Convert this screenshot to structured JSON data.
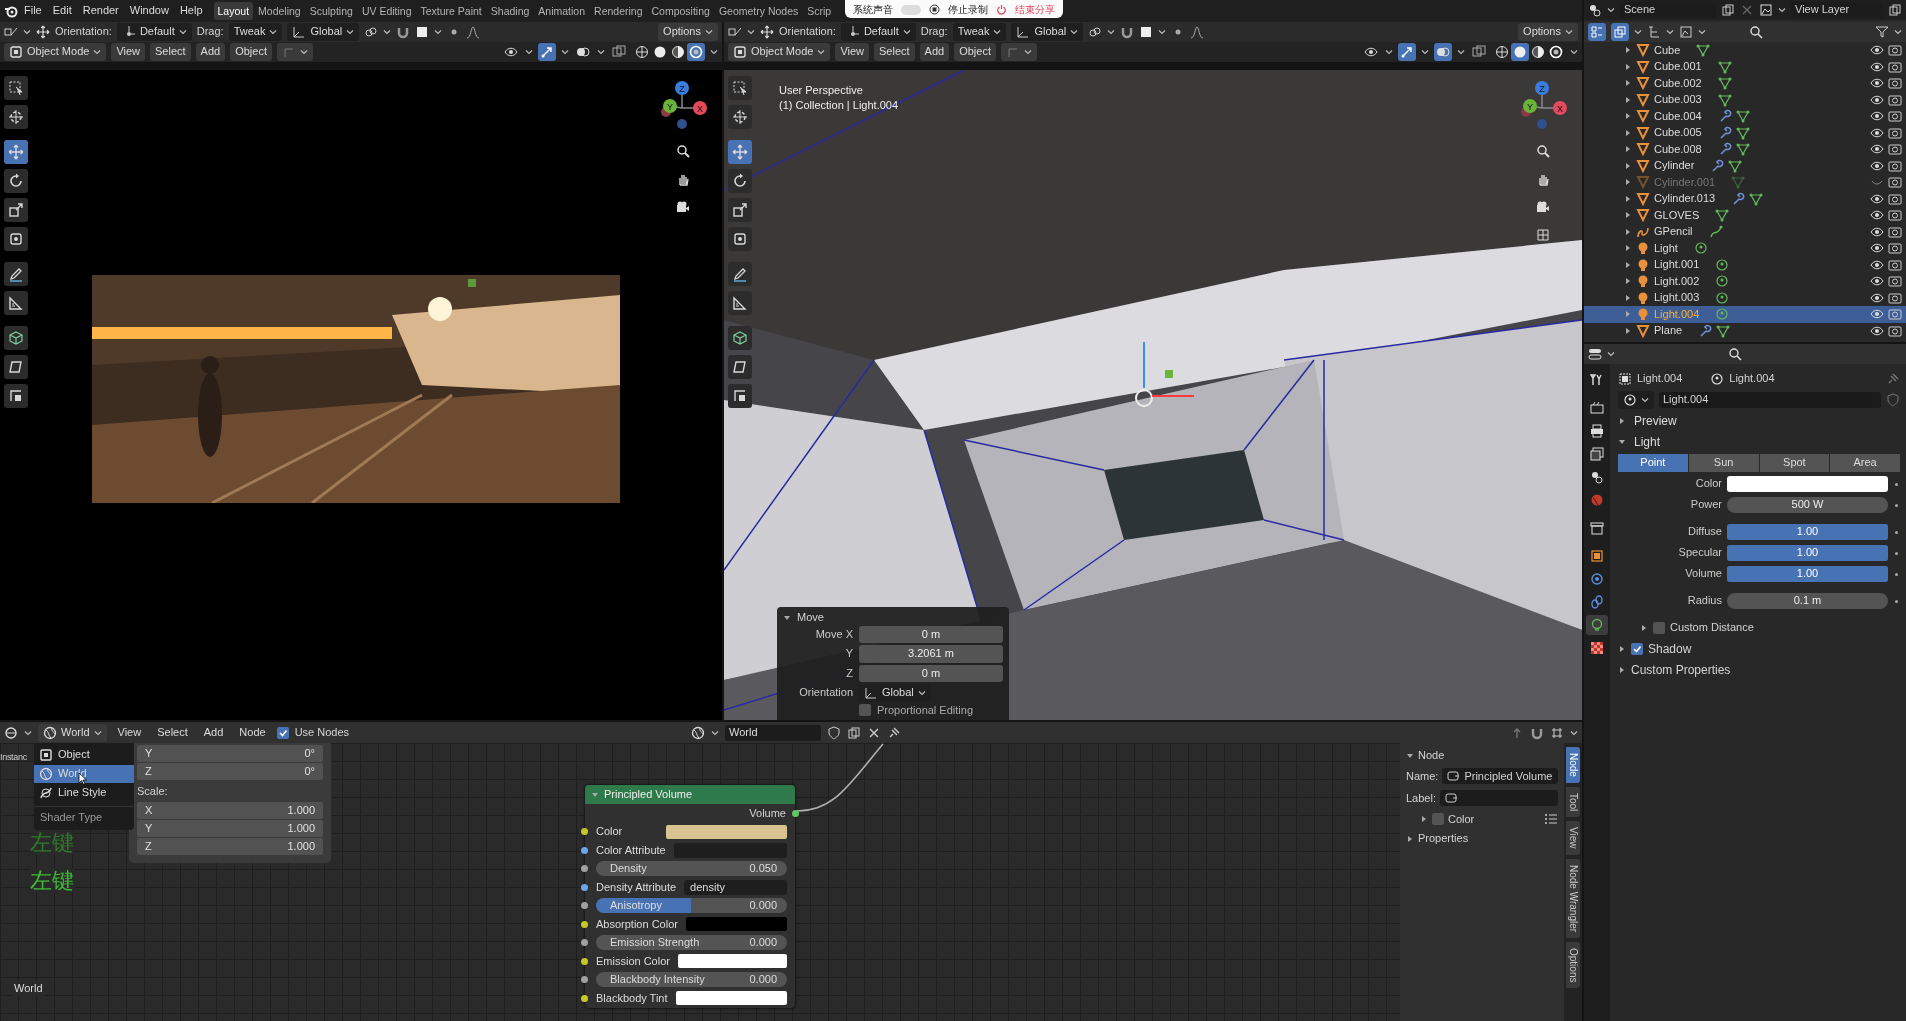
{
  "menu_bar": {
    "menus": [
      "File",
      "Edit",
      "Render",
      "Window",
      "Help"
    ],
    "workspaces": [
      {
        "label": "Layout",
        "selected": true
      },
      {
        "label": "Modeling",
        "selected": false
      },
      {
        "label": "Sculpting",
        "selected": false
      },
      {
        "label": "UV Editing",
        "selected": false
      },
      {
        "label": "Texture Paint",
        "selected": false
      },
      {
        "label": "Shading",
        "selected": false
      },
      {
        "label": "Animation",
        "selected": false
      },
      {
        "label": "Rendering",
        "selected": false
      },
      {
        "label": "Compositing",
        "selected": false
      },
      {
        "label": "Geometry Nodes",
        "selected": false
      },
      {
        "label": "Scrip",
        "selected": false
      }
    ]
  },
  "recording_bar": {
    "sound_label": "系统声音",
    "sound_on": false,
    "stop_label": "停止录制",
    "end_label": "结束分享"
  },
  "viewports": [
    {
      "tool_header": {
        "orientation_label": "Orientation:",
        "orientation": "Default",
        "drag_label": "Drag:",
        "drag": "Tweak",
        "transform": "Global",
        "options": "Options"
      },
      "header": {
        "mode": "Object Mode",
        "menus": [
          "View",
          "Select",
          "Add",
          "Object"
        ],
        "toggles": [
          {
            "kind": "visibility",
            "on": false
          },
          {
            "kind": "gizmo",
            "on": true
          },
          {
            "kind": "overlay",
            "on": false
          },
          {
            "kind": "xray",
            "on": false
          }
        ],
        "shading": [
          {
            "kind": "wireframe",
            "selected": false
          },
          {
            "kind": "solid",
            "selected": false
          },
          {
            "kind": "material",
            "selected": false
          },
          {
            "kind": "rendered",
            "selected": true
          }
        ]
      },
      "tools": [
        {
          "kind": "select",
          "selected": false
        },
        {
          "kind": "cursor",
          "selected": false
        },
        {
          "kind": "move",
          "selected": true
        },
        {
          "kind": "rotate",
          "selected": false
        },
        {
          "kind": "scale",
          "selected": false
        },
        {
          "kind": "transform",
          "selected": false
        },
        {
          "kind": "annotate",
          "selected": false
        },
        {
          "kind": "measure",
          "selected": false
        },
        {
          "kind": "add_cube",
          "selected": false
        },
        {
          "kind": "shear",
          "selected": false
        },
        {
          "kind": "rip",
          "selected": false
        }
      ],
      "gizmo": {
        "axes": [
          "Z",
          "Y",
          "X"
        ]
      },
      "content": {
        "kind": "render_preview"
      }
    },
    {
      "tool_header": {
        "orientation_label": "Orientation:",
        "orientation": "Default",
        "drag_label": "Drag:",
        "drag": "Tweak",
        "transform": "Global",
        "options": "Options"
      },
      "header": {
        "mode": "Object Mode",
        "menus": [
          "View",
          "Select",
          "Add",
          "Object"
        ],
        "toggles": [
          {
            "kind": "visibility",
            "on": false
          },
          {
            "kind": "gizmo",
            "on": true
          },
          {
            "kind": "overlay",
            "on": true
          },
          {
            "kind": "xray",
            "on": false
          }
        ],
        "shading": [
          {
            "kind": "wireframe",
            "selected": false
          },
          {
            "kind": "solid",
            "selected": true
          },
          {
            "kind": "material",
            "selected": false
          },
          {
            "kind": "rendered",
            "selected": false
          }
        ]
      },
      "tools": [
        {
          "kind": "select",
          "selected": false
        },
        {
          "kind": "cursor",
          "selected": false
        },
        {
          "kind": "move",
          "selected": true
        },
        {
          "kind": "rotate",
          "selected": false
        },
        {
          "kind": "scale",
          "selected": false
        },
        {
          "kind": "transform",
          "selected": false
        },
        {
          "kind": "annotate",
          "selected": false
        },
        {
          "kind": "measure",
          "selected": false
        },
        {
          "kind": "add_cube",
          "selected": false
        },
        {
          "kind": "shear",
          "selected": false
        },
        {
          "kind": "rip",
          "selected": false
        }
      ],
      "gizmo": {
        "axes": [
          "Z",
          "Y",
          "X"
        ]
      },
      "content": {
        "kind": "scene_view",
        "info": [
          "User Perspective",
          "(1) Collection | Light.004"
        ],
        "move_panel": {
          "title": "Move",
          "fields": [
            {
              "label": "Move X",
              "value": "0 m"
            },
            {
              "label": "Y",
              "value": "3.2061 m"
            },
            {
              "label": "Z",
              "value": "0 m"
            }
          ],
          "orientation_label": "Orientation",
          "orientation": "Global",
          "proportional": {
            "label": "Proportional Editing",
            "checked": false
          }
        }
      }
    }
  ],
  "outliner": {
    "scene": "Scene",
    "view_layer": "View Layer",
    "items": [
      {
        "name": "Cube",
        "kind": "mesh",
        "modifier": false,
        "hidden": false,
        "selected": false
      },
      {
        "name": "Cube.001",
        "kind": "mesh",
        "modifier": false,
        "hidden": false,
        "selected": false
      },
      {
        "name": "Cube.002",
        "kind": "mesh",
        "modifier": false,
        "hidden": false,
        "selected": false
      },
      {
        "name": "Cube.003",
        "kind": "mesh",
        "modifier": false,
        "hidden": false,
        "selected": false
      },
      {
        "name": "Cube.004",
        "kind": "mesh",
        "modifier": true,
        "hidden": false,
        "selected": false
      },
      {
        "name": "Cube.005",
        "kind": "mesh",
        "modifier": true,
        "hidden": false,
        "selected": false
      },
      {
        "name": "Cube.008",
        "kind": "mesh",
        "modifier": true,
        "hidden": false,
        "selected": false
      },
      {
        "name": "Cylinder",
        "kind": "mesh",
        "modifier": true,
        "hidden": false,
        "selected": false
      },
      {
        "name": "Cylinder.001",
        "kind": "mesh",
        "modifier": false,
        "hidden": true,
        "selected": false
      },
      {
        "name": "Cylinder.013",
        "kind": "mesh",
        "modifier": true,
        "hidden": false,
        "selected": false
      },
      {
        "name": "GLOVES",
        "kind": "mesh",
        "modifier": false,
        "hidden": false,
        "selected": false
      },
      {
        "name": "GPencil",
        "kind": "gpencil",
        "modifier": false,
        "hidden": false,
        "selected": false
      },
      {
        "name": "Light",
        "kind": "light",
        "modifier": false,
        "hidden": false,
        "selected": false
      },
      {
        "name": "Light.001",
        "kind": "light",
        "modifier": false,
        "hidden": false,
        "selected": false
      },
      {
        "name": "Light.002",
        "kind": "light",
        "modifier": false,
        "hidden": false,
        "selected": false
      },
      {
        "name": "Light.003",
        "kind": "light",
        "modifier": false,
        "hidden": false,
        "selected": false
      },
      {
        "name": "Light.004",
        "kind": "light",
        "modifier": false,
        "hidden": false,
        "selected": true
      },
      {
        "name": "Plane",
        "kind": "mesh",
        "modifier": true,
        "hidden": false,
        "selected": false
      }
    ]
  },
  "properties": {
    "tabs": [
      {
        "kind": "tool",
        "selected": false
      },
      {
        "kind": "render",
        "selected": false
      },
      {
        "kind": "output",
        "selected": false
      },
      {
        "kind": "view_layer",
        "selected": false
      },
      {
        "kind": "scene",
        "selected": false
      },
      {
        "kind": "world",
        "selected": false
      },
      {
        "kind": "collection",
        "selected": false
      },
      {
        "kind": "object",
        "selected": false
      },
      {
        "kind": "physics",
        "selected": false
      },
      {
        "kind": "constraints",
        "selected": false
      },
      {
        "kind": "data",
        "selected": true
      },
      {
        "kind": "texture",
        "selected": false
      }
    ],
    "object": "Light.004",
    "data": "Light.004",
    "datablock": "Light.004",
    "sections": [
      {
        "label": "Preview",
        "expanded": false
      },
      {
        "label": "Light",
        "expanded": true
      }
    ],
    "light_types": [
      {
        "label": "Point",
        "selected": true
      },
      {
        "label": "Sun",
        "selected": false
      },
      {
        "label": "Spot",
        "selected": false
      },
      {
        "label": "Area",
        "selected": false
      }
    ],
    "fields": [
      {
        "kind": "color",
        "label": "Color",
        "color": "#ffffff"
      },
      {
        "kind": "number",
        "label": "Power",
        "value": "500 W"
      },
      {
        "kind": "factor",
        "label": "Diffuse",
        "value": "1.00",
        "level": 1
      },
      {
        "kind": "factor",
        "label": "Specular",
        "value": "1.00",
        "level": 1
      },
      {
        "kind": "factor",
        "label": "Volume",
        "value": "1.00",
        "level": 1
      },
      {
        "kind": "number",
        "label": "Radius",
        "value": "0.1 m"
      }
    ],
    "custom_distance": {
      "label": "Custom Distance",
      "checked": false
    },
    "lower_sections": [
      {
        "label": "Shadow",
        "kind": "checkbox",
        "checked": true
      },
      {
        "label": "Custom Properties",
        "kind": "plain"
      }
    ]
  },
  "node_editor": {
    "header": {
      "type": "World",
      "menus": [
        "View",
        "Select",
        "Add",
        "Node"
      ],
      "use_nodes": {
        "label": "Use Nodes",
        "checked": true
      },
      "world": "World"
    },
    "side_text": "Instanc",
    "type_menu": {
      "items": [
        {
          "kind": "object",
          "label": "Object",
          "selected": false
        },
        {
          "kind": "world",
          "label": "World",
          "selected": true
        },
        {
          "kind": "line_style",
          "label": "Line Style",
          "selected": false
        }
      ],
      "title": "Shader Type"
    },
    "transform_panel": {
      "rows": [
        {
          "label": "Y",
          "value": "0°"
        },
        {
          "label": "Z",
          "value": "0°"
        }
      ],
      "scale_label": "Scale:",
      "scale_rows": [
        {
          "label": "X",
          "value": "1.000"
        },
        {
          "label": "Y",
          "value": "1.000"
        },
        {
          "label": "Z",
          "value": "1.000"
        }
      ]
    },
    "captions": [
      {
        "text": "左键",
        "color": "#2f7a2a"
      },
      {
        "text": "左键",
        "color": "#3dbb35"
      }
    ],
    "context_label": "World",
    "node": {
      "title": "Principled Volume",
      "output": "Volume",
      "inputs": [
        {
          "kind": "color",
          "label": "Color",
          "socket": {
            "color": "#c7c729"
          },
          "color": "#d8c391"
        },
        {
          "kind": "text",
          "label": "Color Attribute",
          "socket": {
            "color": "#6ca6e8"
          }
        },
        {
          "kind": "value",
          "label": "Density",
          "socket": {
            "color": "#a1a1a1"
          },
          "value": "0.050"
        },
        {
          "kind": "text",
          "label": "Density Attribute",
          "socket": {
            "color": "#6ca6e8"
          },
          "value": "density"
        },
        {
          "kind": "slider",
          "label": "Anisotropy",
          "socket": {
            "color": "#a1a1a1"
          },
          "value": "0.000",
          "level": 0.5
        },
        {
          "kind": "color",
          "label": "Absorption Color",
          "socket": {
            "color": "#c7c729"
          },
          "color": "#000000"
        },
        {
          "kind": "value",
          "label": "Emission Strength",
          "socket": {
            "color": "#a1a1a1"
          },
          "value": "0.000"
        },
        {
          "kind": "color",
          "label": "Emission Color",
          "socket": {
            "color": "#c7c729"
          },
          "color": "#ffffff"
        },
        {
          "kind": "value",
          "label": "Blackbody Intensity",
          "socket": {
            "color": "#a1a1a1"
          },
          "value": "0.000"
        },
        {
          "kind": "color",
          "label": "Blackbody Tint",
          "socket": {
            "color": "#c7c729"
          },
          "color": "#ffffff"
        }
      ]
    },
    "sidebar": {
      "panel": "Node",
      "name_label": "Name:",
      "name": "Principled Volume",
      "label_label": "Label:",
      "color": {
        "label": "Color",
        "checked": false
      },
      "properties": "Properties",
      "tabs": [
        {
          "label": "Node",
          "selected": true
        },
        {
          "label": "Tool",
          "selected": false
        },
        {
          "label": "View",
          "selected": false
        },
        {
          "label": "Node Wrangler",
          "selected": false
        },
        {
          "label": "Options",
          "selected": false
        }
      ]
    }
  }
}
